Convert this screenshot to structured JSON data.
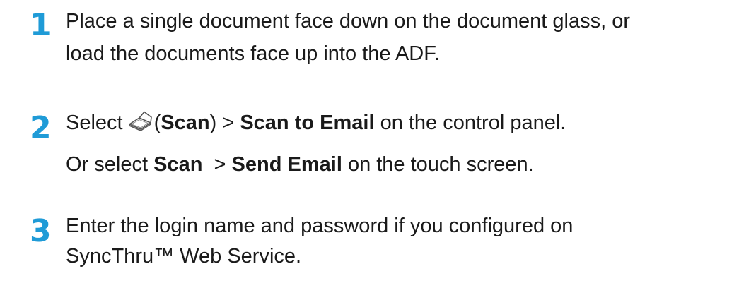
{
  "steps": [
    {
      "number": "1",
      "line1": "Place a single document face down on the document glass, or",
      "line2": "load the documents face up into the ADF."
    },
    {
      "number": "2",
      "line1": {
        "select": "Select",
        "open_paren": "(",
        "scan": "Scan",
        "close_paren": ") >",
        "scan_to_email": "Scan to Email",
        "tail": "on the control panel."
      },
      "icon": "scan-icon",
      "line2": {
        "or_select": "Or select",
        "scan": "Scan",
        "gt": ">",
        "send_email": "Send Email",
        "tail": "on the touch screen."
      }
    },
    {
      "number": "3",
      "line1": "Enter the login name and password if you configured on",
      "line2": "SyncThru™ Web Service."
    }
  ],
  "colors": {
    "step_number": "#1f9bd7",
    "text": "#1a1a1a"
  }
}
